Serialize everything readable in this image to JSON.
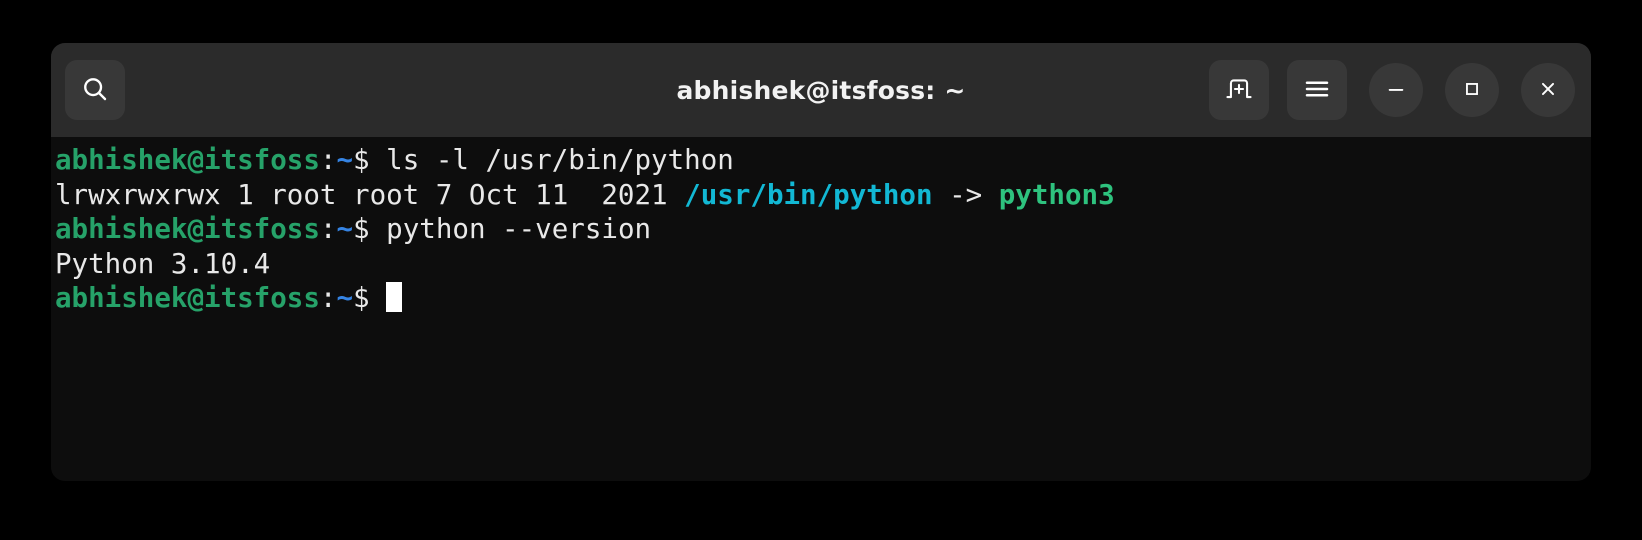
{
  "window": {
    "title": "abhishek@itsfoss: ~",
    "background_color": "#000000",
    "header_color": "#2b2b2b",
    "body_color": "#0d0d0d"
  },
  "titlebar": {
    "search_label": "search-icon",
    "new_tab_label": "new-tab-icon",
    "menu_label": "hamburger-menu-icon",
    "minimize_label": "minimize-icon",
    "maximize_label": "maximize-icon",
    "close_label": "close-icon"
  },
  "colors": {
    "prompt_user_host": "#26a269",
    "prompt_path": "#3584e4",
    "prompt_symbol": "#e8e8e8",
    "symlink_path": "#12b8d4",
    "symlink_target": "#2ec27e",
    "default_text": "#e8e8e8",
    "cursor": "#ffffff"
  },
  "terminal": {
    "prompt": {
      "user_host": "abhishek@itsfoss",
      "colon": ":",
      "path": "~",
      "symbol": "$ "
    },
    "lines": [
      {
        "type": "command",
        "segments": [
          {
            "text": "abhishek@itsfoss",
            "color": "c-green"
          },
          {
            "text": ":",
            "color": "c-white"
          },
          {
            "text": "~",
            "color": "c-blue"
          },
          {
            "text": "$ ",
            "color": "c-white"
          },
          {
            "text": "ls -l /usr/bin/python",
            "color": "c-plain"
          }
        ]
      },
      {
        "type": "output",
        "segments": [
          {
            "text": "lrwxrwxrwx 1 root root 7 Oct 11  2021 ",
            "color": "c-plain"
          },
          {
            "text": "/usr/bin/python",
            "color": "c-cyan"
          },
          {
            "text": " -> ",
            "color": "c-plain"
          },
          {
            "text": "python3",
            "color": "c-green-b"
          }
        ]
      },
      {
        "type": "command",
        "segments": [
          {
            "text": "abhishek@itsfoss",
            "color": "c-green"
          },
          {
            "text": ":",
            "color": "c-white"
          },
          {
            "text": "~",
            "color": "c-blue"
          },
          {
            "text": "$ ",
            "color": "c-white"
          },
          {
            "text": "python --version",
            "color": "c-plain"
          }
        ]
      },
      {
        "type": "output",
        "segments": [
          {
            "text": "Python 3.10.4",
            "color": "c-plain"
          }
        ]
      },
      {
        "type": "prompt",
        "segments": [
          {
            "text": "abhishek@itsfoss",
            "color": "c-green"
          },
          {
            "text": ":",
            "color": "c-white"
          },
          {
            "text": "~",
            "color": "c-blue"
          },
          {
            "text": "$ ",
            "color": "c-white"
          }
        ],
        "cursor": true
      }
    ]
  }
}
